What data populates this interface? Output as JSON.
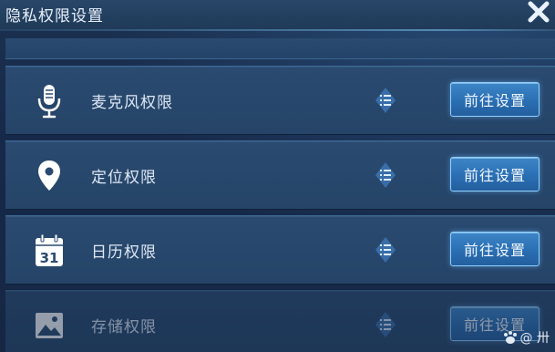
{
  "window": {
    "title": "隐私权限设置"
  },
  "rows": [
    {
      "label": "麦克风权限",
      "button_label": "前往设置",
      "icon": "microphone-icon"
    },
    {
      "label": "定位权限",
      "button_label": "前往设置",
      "icon": "location-pin-icon"
    },
    {
      "label": "日历权限",
      "button_label": "前往设置",
      "icon": "calendar-icon",
      "calendar_day": "31"
    },
    {
      "label": "存储权限",
      "button_label": "前往设置",
      "icon": "image-icon"
    }
  ],
  "watermark": {
    "text": "@  卅"
  },
  "colors": {
    "accent": "#3d86c8",
    "button_border": "#8fd0ff",
    "background": "#16283f",
    "text": "#dde8f5"
  }
}
